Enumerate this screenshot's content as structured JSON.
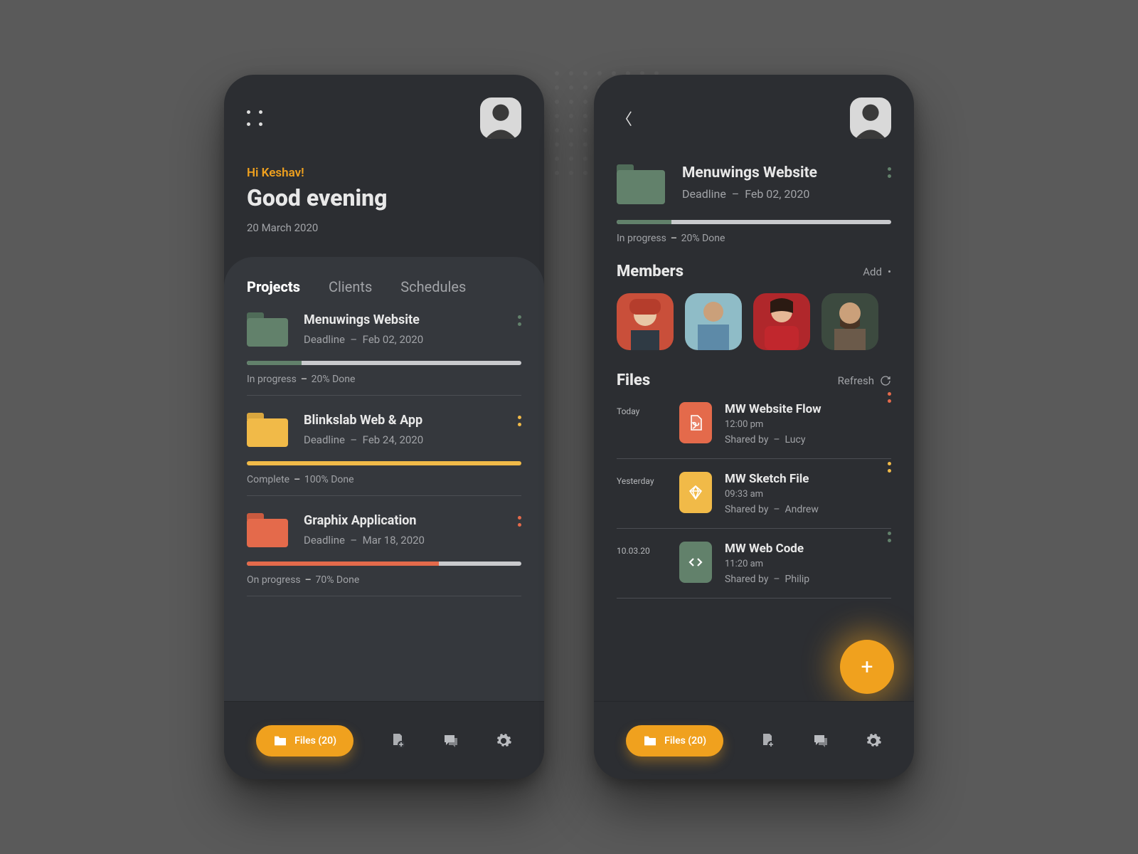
{
  "home": {
    "greeting_name": "Hi Keshav!",
    "greeting_title": "Good evening",
    "date": "20 March 2020",
    "tabs": {
      "projects": "Projects",
      "clients": "Clients",
      "schedules": "Schedules"
    },
    "projects": [
      {
        "name": "Menuwings Website",
        "deadline_label": "Deadline",
        "deadline_date": "Feb 02, 2020",
        "status": "In progress",
        "done_label": "20% Done",
        "percent": 20,
        "color": "green"
      },
      {
        "name": "Blinkslab Web & App",
        "deadline_label": "Deadline",
        "deadline_date": "Feb 24, 2020",
        "status": "Complete",
        "done_label": "100% Done",
        "percent": 100,
        "color": "yellow"
      },
      {
        "name": "Graphix Application",
        "deadline_label": "Deadline",
        "deadline_date": "Mar 18, 2020",
        "status": "On progress",
        "done_label": "70% Done",
        "percent": 70,
        "color": "orange"
      }
    ],
    "nav_files_label": "Files (20)"
  },
  "detail": {
    "project": {
      "name": "Menuwings Website",
      "deadline_label": "Deadline",
      "deadline_date": "Feb 02, 2020",
      "status": "In progress",
      "done_label": "20% Done",
      "percent": 20
    },
    "members_title": "Members",
    "members_add": "Add",
    "files_title": "Files",
    "files_refresh": "Refresh",
    "files": [
      {
        "day": "Today",
        "name": "MW Website Flow",
        "time": "12:00 pm",
        "shared_label": "Shared by",
        "shared_by": "Lucy",
        "color": "#e46a4b",
        "icon": "pdf",
        "dot": "orange"
      },
      {
        "day": "Yesterday",
        "name": "MW Sketch File",
        "time": "09:33 am",
        "shared_label": "Shared by",
        "shared_by": "Andrew",
        "color": "#f1ba48",
        "icon": "sketch",
        "dot": "yellow"
      },
      {
        "day": "10.03.20",
        "name": "MW Web Code",
        "time": "11:20 am",
        "shared_label": "Shared by",
        "shared_by": "Philip",
        "color": "#62816b",
        "icon": "code",
        "dot": "green"
      }
    ],
    "nav_files_label": "Files (20)"
  }
}
